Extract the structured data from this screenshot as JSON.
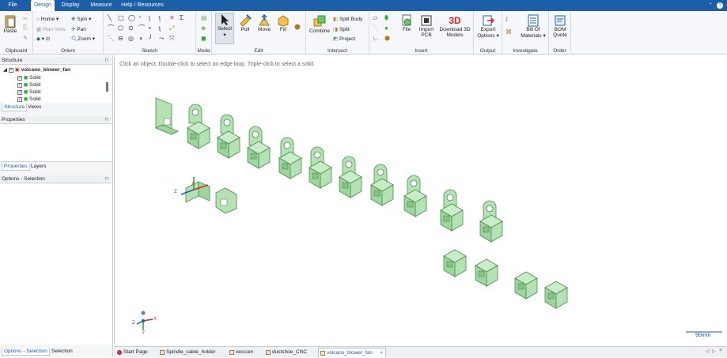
{
  "menubar": {
    "items": [
      "File",
      "Design",
      "Display",
      "Measure",
      "Help / Resources"
    ],
    "right_icons": [
      "collapse-icon",
      "help-icon"
    ]
  },
  "ribbon": {
    "clipboard": {
      "label": "Clipboard",
      "paste": "Paste"
    },
    "orient": {
      "label": "Orient",
      "home": "Home",
      "spin": "Spin",
      "plan_view": "Plan View",
      "pan": "Pan",
      "zoom": "Zoom"
    },
    "sketch": {
      "label": "Sketch"
    },
    "mode": {
      "label": "Mode"
    },
    "edit": {
      "label": "Edit",
      "select": "Select",
      "pull": "Pull",
      "move": "Move",
      "fill": "Fill"
    },
    "intersect": {
      "label": "Intersect",
      "combine": "Combine",
      "split_body": "Split Body",
      "split": "Split",
      "project": "Project"
    },
    "insert": {
      "label": "Insert",
      "file": "File",
      "import_pcb_1": "Import",
      "import_pcb_2": "PCB",
      "download_1": "Download 3D",
      "download_2": "Models"
    },
    "output": {
      "label": "Output",
      "export_1": "Export",
      "export_2": "Options"
    },
    "investigate": {
      "label": "Investigate",
      "bom_1": "Bill Of",
      "bom_2": "Materials"
    },
    "order": {
      "label": "Order",
      "quote_1": "BOM",
      "quote_2": "Quote"
    }
  },
  "structure": {
    "title": "Structure",
    "root": "volcano_blower_fan",
    "items": [
      "Solid",
      "Solid",
      "Solid",
      "Solid"
    ],
    "tabs": [
      "Structure",
      "Views"
    ]
  },
  "properties": {
    "title": "Properties",
    "tabs": [
      "Properties",
      "Layers"
    ]
  },
  "options": {
    "title": "Options - Selection",
    "bottom_tabs": [
      "Options - Selection",
      "Selection"
    ]
  },
  "canvas": {
    "hint": "Click an object. Double-click to select an edge loop. Triple-click to select a solid.",
    "scale_label": "90mm",
    "axis_labels": {
      "x": "X",
      "y": "Y",
      "z": "Z"
    }
  },
  "doc_tabs": [
    {
      "label": "Start Page"
    },
    {
      "label": "Spindle_cable_holder"
    },
    {
      "label": "veccum"
    },
    {
      "label": "dustshoe_CNC"
    },
    {
      "label": "volcano_blower_fan"
    }
  ],
  "colors": {
    "brand": "#1c5fa8",
    "part": "#a9dca9",
    "part_edge": "#4d8a4d"
  }
}
